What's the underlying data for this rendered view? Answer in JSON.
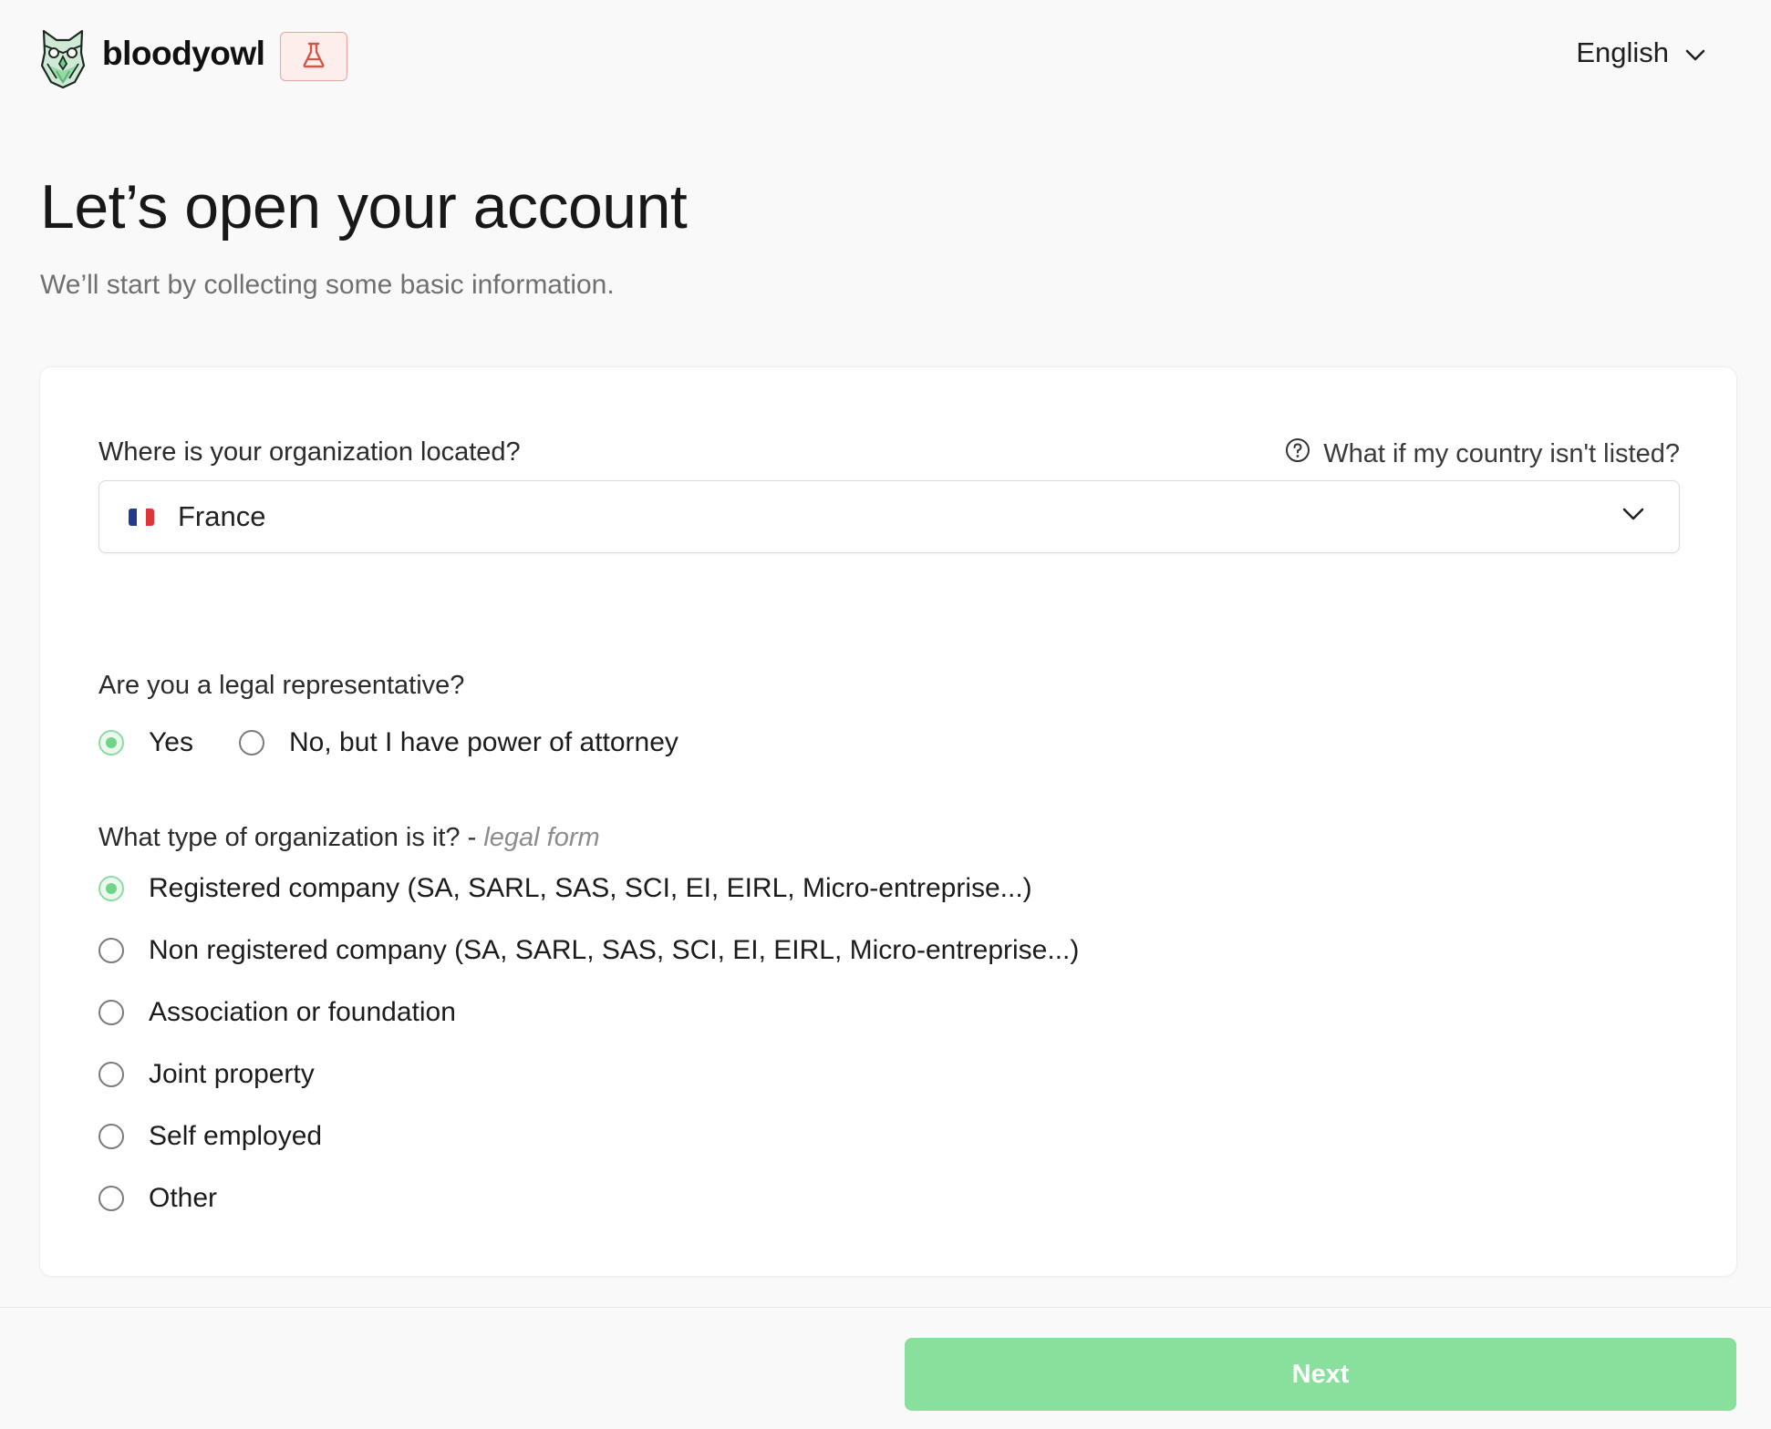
{
  "header": {
    "brand": "bloodyowl",
    "language": "English",
    "logo_icon": "owl-logo-icon",
    "badge_icon": "flask-icon"
  },
  "page": {
    "title": "Let’s open your account",
    "subtitle": "We’ll start by collecting some basic information."
  },
  "location": {
    "label": "Where is your organization located?",
    "help_link": "What if my country isn't listed?",
    "selected_country": "France",
    "flag_colors": [
      "#233b8f",
      "#ffffff",
      "#e0343b"
    ]
  },
  "legal_rep": {
    "label": "Are you a legal representative?",
    "options": [
      {
        "label": "Yes",
        "checked": true
      },
      {
        "label": "No, but I have power of attorney",
        "checked": false
      }
    ]
  },
  "org_type": {
    "label": "What type of organization is it? - ",
    "label_hint": "legal form",
    "options": [
      {
        "label": "Registered company (SA, SARL, SAS, SCI, EI, EIRL, Micro-entreprise...)",
        "checked": true
      },
      {
        "label": "Non registered company (SA, SARL, SAS, SCI, EI, EIRL, Micro-entreprise...)",
        "checked": false
      },
      {
        "label": "Association or foundation",
        "checked": false
      },
      {
        "label": "Joint property",
        "checked": false
      },
      {
        "label": "Self employed",
        "checked": false
      },
      {
        "label": "Other",
        "checked": false
      }
    ]
  },
  "footer": {
    "next_label": "Next"
  },
  "colors": {
    "accent": "#89e09c",
    "radio_checked": "#6fd38a",
    "badge_border": "#e4a8a0",
    "badge_icon": "#d0574a"
  }
}
